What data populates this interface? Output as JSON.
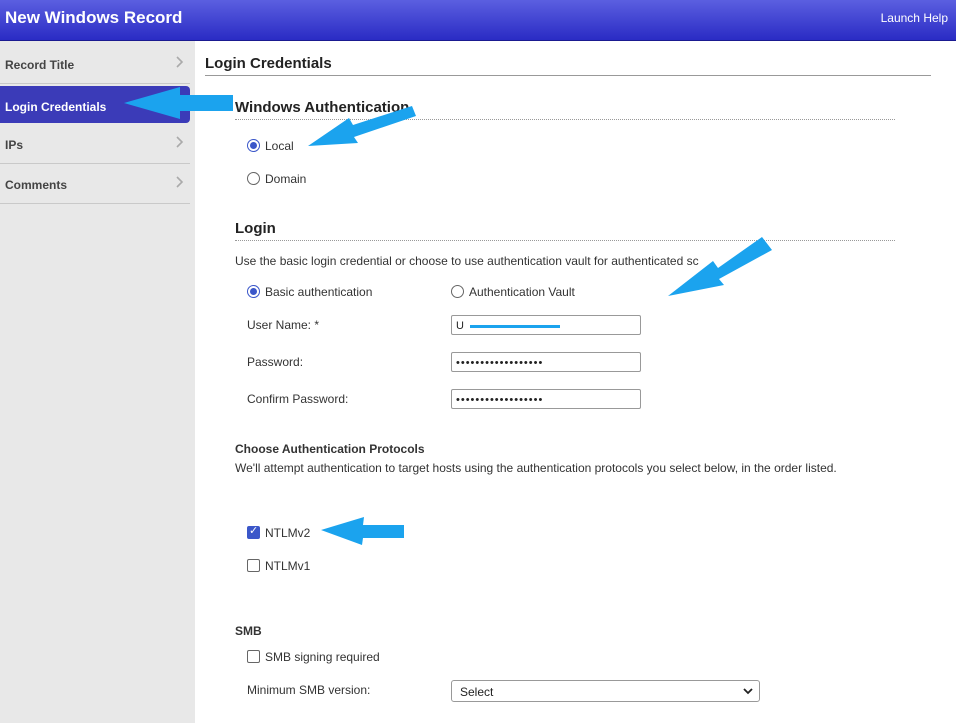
{
  "window": {
    "title": "New Windows Record",
    "help_link": "Launch Help"
  },
  "sidebar": {
    "items": [
      {
        "label": "Record Title",
        "active": false
      },
      {
        "label": "Login Credentials",
        "active": true
      },
      {
        "label": "IPs",
        "active": false
      },
      {
        "label": "Comments",
        "active": false
      }
    ]
  },
  "main": {
    "section_title": "Login Credentials",
    "windows_auth": {
      "heading": "Windows Authentication",
      "options": [
        {
          "label": "Local",
          "selected": true
        },
        {
          "label": "Domain",
          "selected": false
        }
      ]
    },
    "login": {
      "heading": "Login",
      "description": "Use the basic login credential or choose to use authentication vault for authenticated sc",
      "options": [
        {
          "label": "Basic authentication",
          "selected": true
        },
        {
          "label": "Authentication Vault",
          "selected": false
        }
      ],
      "fields": [
        {
          "label": "User Name: *",
          "value": "U"
        },
        {
          "label": "Password:",
          "value": "••••••••••••••••••"
        },
        {
          "label": "Confirm Password:",
          "value": "••••••••••••••••••"
        }
      ]
    },
    "protocols": {
      "heading": "Choose Authentication Protocols",
      "description": "We'll attempt authentication to target hosts using the authentication protocols you select below, in the order listed.",
      "options": [
        {
          "label": "NTLMv2",
          "checked": true
        },
        {
          "label": "NTLMv1",
          "checked": false
        }
      ]
    },
    "smb": {
      "heading": "SMB",
      "signing_label": "SMB signing required",
      "signing_checked": false,
      "min_version_label": "Minimum SMB version:",
      "min_version_value": "Select"
    }
  },
  "colors": {
    "titlebar": "#3b3bc8",
    "active_nav": "#3b3bb8",
    "accent": "#3b57c9",
    "annotation_arrow": "#1ba3ee"
  }
}
